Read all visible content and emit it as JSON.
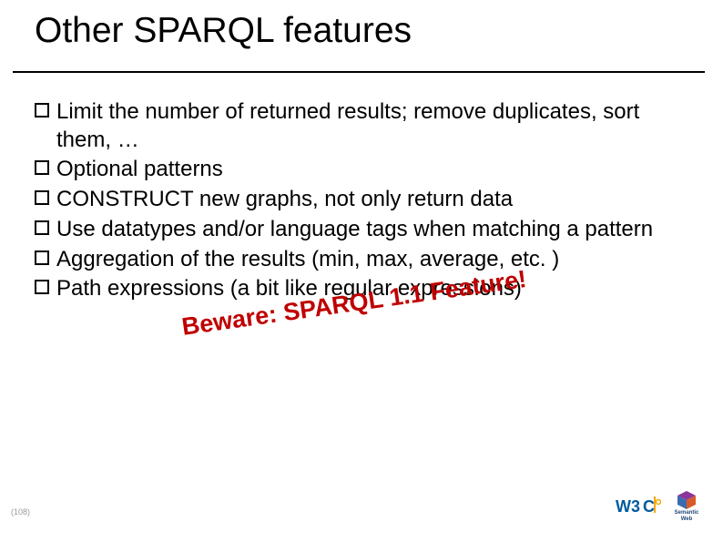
{
  "title": "Other SPARQL features",
  "bullets": [
    "Limit the number of returned results; remove duplicates, sort them, …",
    "Optional patterns",
    "CONSTRUCT new graphs, not only return data",
    "Use datatypes and/or language tags when matching a pattern",
    "Aggregation of the results (min, max, average, etc. )",
    "Path expressions (a bit like regular expressions)"
  ],
  "overlay_text": "Beware: SPARQL 1.1 Feature!",
  "page_number": "(108)",
  "logos": {
    "w3c_label": "W3C",
    "sw_label_line1": "Semantic",
    "sw_label_line2": "Web"
  }
}
